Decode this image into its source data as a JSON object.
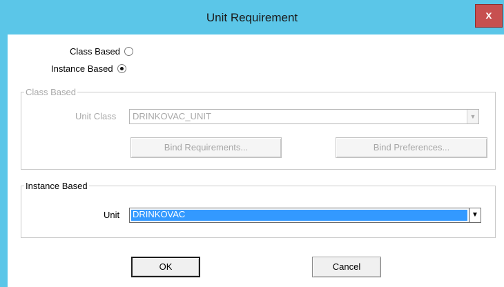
{
  "window": {
    "title": "Unit Requirement",
    "close_glyph": "x",
    "accent_color": "#5bc6e8"
  },
  "mode": {
    "class_based_label": "Class Based",
    "instance_based_label": "Instance Based",
    "selected": "Instance Based"
  },
  "class_group": {
    "legend": "Class Based",
    "unit_class_label": "Unit Class",
    "unit_class_value": "DRINKOVAC_UNIT",
    "bind_requirements_label": "Bind Requirements...",
    "bind_preferences_label": "Bind Preferences..."
  },
  "instance_group": {
    "legend": "Instance Based",
    "unit_label": "Unit",
    "unit_value": "DRINKOVAC"
  },
  "footer": {
    "ok_label": "OK",
    "cancel_label": "Cancel"
  },
  "icons": {
    "dropdown_arrow": "▼"
  }
}
